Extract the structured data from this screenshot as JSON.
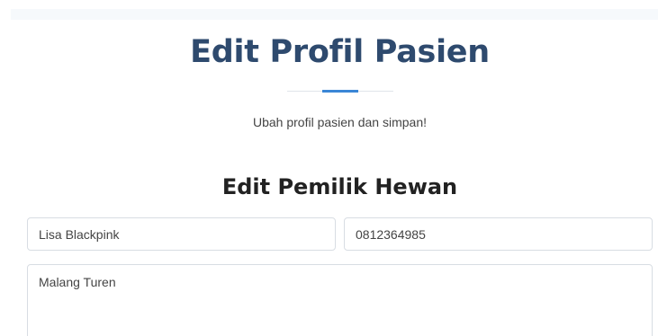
{
  "page": {
    "title": "Edit Profil Pasien",
    "subtitle": "Ubah profil pasien dan simpan!"
  },
  "owner_section": {
    "title": "Edit Pemilik Hewan",
    "name_value": "Lisa Blackpink",
    "phone_value": "0812364985",
    "address_value": "Malang Turen"
  },
  "colors": {
    "title": "#2e4a6e",
    "accent": "#3a86d6",
    "section_title": "#222222",
    "field_border": "#d8dde3"
  }
}
